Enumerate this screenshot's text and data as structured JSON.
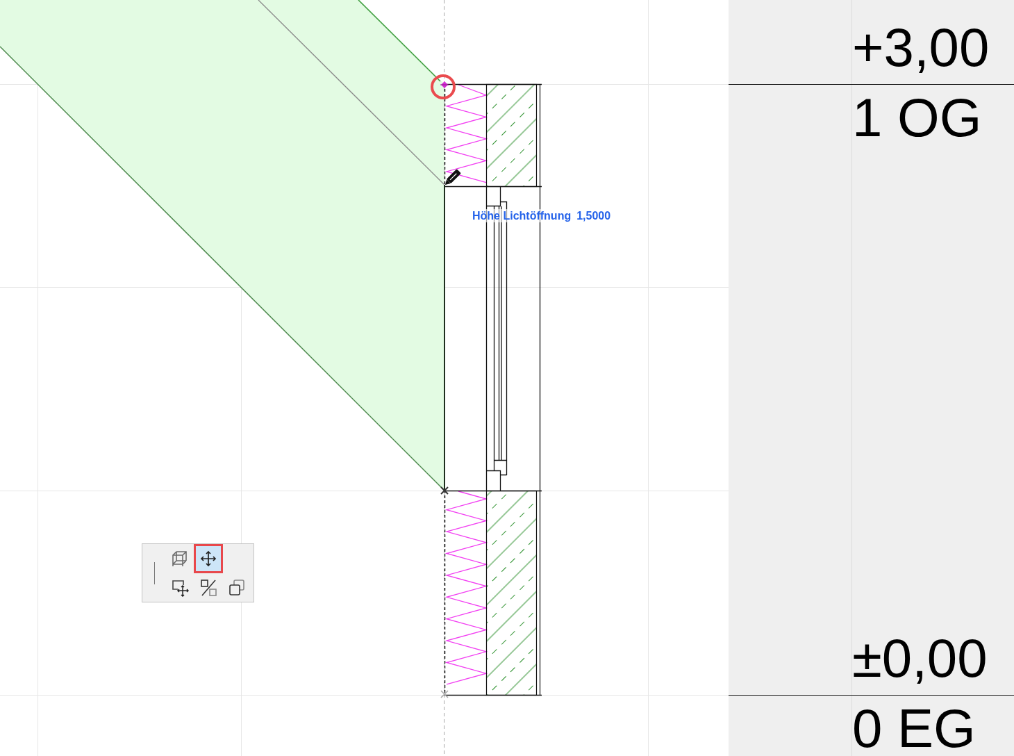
{
  "levels": [
    {
      "elevation": "+3,00",
      "name": "1 OG"
    },
    {
      "elevation": "±0,00",
      "name": "0 EG"
    }
  ],
  "opening_parameter": {
    "label": "Höhe Lichtöffnung",
    "value": "1,5000"
  },
  "pet_palette": {
    "buttons": [
      {
        "selected": false
      },
      {
        "selected": true
      },
      {
        "selected": false
      },
      {
        "selected": false
      },
      {
        "selected": false
      }
    ]
  }
}
